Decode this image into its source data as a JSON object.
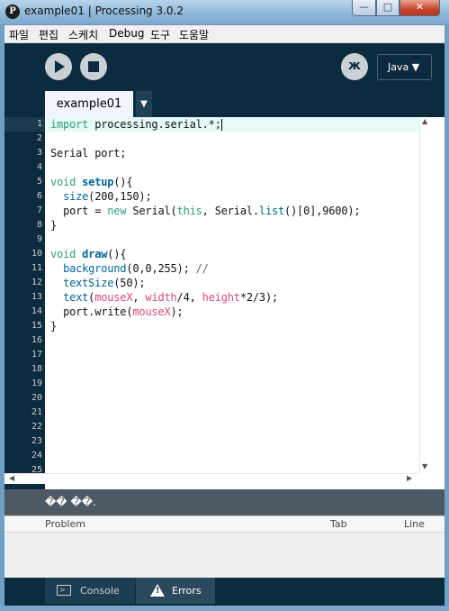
{
  "window": {
    "title": "example01 | Processing 3.0.2",
    "icon_letter": "P",
    "controls": {
      "minimize": "—",
      "maximize": "□",
      "close": "✕"
    }
  },
  "menu": [
    "파일",
    "편집",
    "스케치",
    "Debug",
    "도구",
    "도움말"
  ],
  "toolbar": {
    "run_icon": "play-icon",
    "stop_icon": "stop-icon",
    "debug_icon": "butterfly-icon",
    "mode_label": "Java ▼"
  },
  "tabs": [
    {
      "label": "example01"
    }
  ],
  "tab_menu_glyph": "▼",
  "editor": {
    "line_numbers": [
      "1",
      "2",
      "3",
      "4",
      "5",
      "6",
      "7",
      "8",
      "9",
      "10",
      "11",
      "12",
      "13",
      "14",
      "15",
      "16",
      "17",
      "18",
      "19",
      "20",
      "21",
      "22",
      "23",
      "24",
      "25"
    ],
    "lines": [
      "import processing.serial.*;",
      "",
      "Serial port;",
      "",
      "void setup(){",
      "  size(200,150);",
      "  port = new Serial(this, Serial.list()[0],9600);",
      "}",
      "",
      "void draw(){",
      "  background(0,0,255); //",
      "  textSize(50);",
      "  text(mouseX, width/4, height*2/3);",
      "  port.write(mouseX);",
      "}"
    ],
    "current_line": 1
  },
  "status": {
    "message": "�� ��."
  },
  "errors": {
    "columns": {
      "problem": "Problem",
      "tab": "Tab",
      "line": "Line"
    }
  },
  "footer_tabs": {
    "console": "Console",
    "errors": "Errors"
  },
  "colors": {
    "ide_bg": "#0d2b3e",
    "keyword": "#33997e",
    "function": "#006699",
    "variable": "#d94a7a",
    "highlight": "#e6fbf7"
  }
}
